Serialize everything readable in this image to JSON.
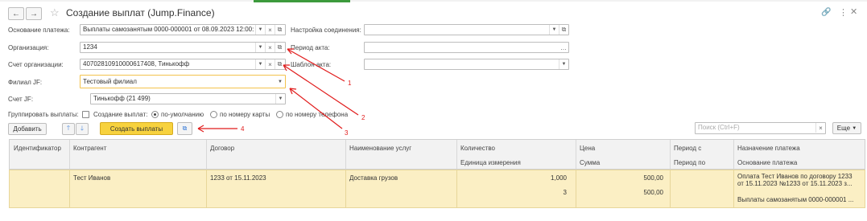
{
  "header": {
    "title": "Создание выплат (Jump.Finance)"
  },
  "form": {
    "osnovanie_label": "Основание платежа:",
    "osnovanie_value": "Выплаты самозанятым 0000-000001 от 08.09.2023 12:00:",
    "org_label": "Организация:",
    "org_value": "1234",
    "schet_org_label": "Счет организации:",
    "schet_org_value": "40702810910000617408, Тинькофф",
    "filial_label": "Филиал JF:",
    "filial_value": "Тестовый филиал",
    "schet_jf_label": "Счет JF:",
    "schet_jf_value": "Тинькофф (21 499)",
    "nastroika_label": "Настройка соединения:",
    "nastroika_value": "",
    "period_label": "Период акта:",
    "period_value": "",
    "shablon_label": "Шаблон акта:",
    "shablon_value": ""
  },
  "grouping": {
    "label": "Группировать выплаты:",
    "create_label": "Создание выплат:",
    "options": [
      "по-умолчанию",
      "по номеру карты",
      "по номеру телефона"
    ],
    "selected": 0
  },
  "toolbar": {
    "add_label": "Добавить",
    "create_label": "Создать выплаты",
    "search_placeholder": "Поиск (Ctrl+F)",
    "more_label": "Еще"
  },
  "annotations": [
    "1",
    "2",
    "3",
    "4"
  ],
  "table": {
    "headers": {
      "id": "Идентификатор",
      "kontragent": "Контрагент",
      "dogovor": "Договор",
      "usluga": "Наименование услуг",
      "kolvo": "Количество",
      "ed": "Единица измерения",
      "cena": "Цена",
      "summa": "Сумма",
      "period_s": "Период с",
      "period_po": "Период по",
      "naznach": "Назначение платежа",
      "osnov": "Основание платежа"
    },
    "row": {
      "kontragent": "Тест Иванов",
      "dogovor": "1233 от 15.11.2023",
      "usluga": "Доставка грузов",
      "kolvo": "1,000",
      "ed": "3",
      "cena": "500,00",
      "summa": "500,00",
      "naznach_1": "Оплата Тест Иванов по договору 1233",
      "naznach_2": "от 15.11.2023 №1233 от 15.11.2023 з...",
      "osnov": "Выплаты самозанятым 0000-000001 ..."
    }
  }
}
